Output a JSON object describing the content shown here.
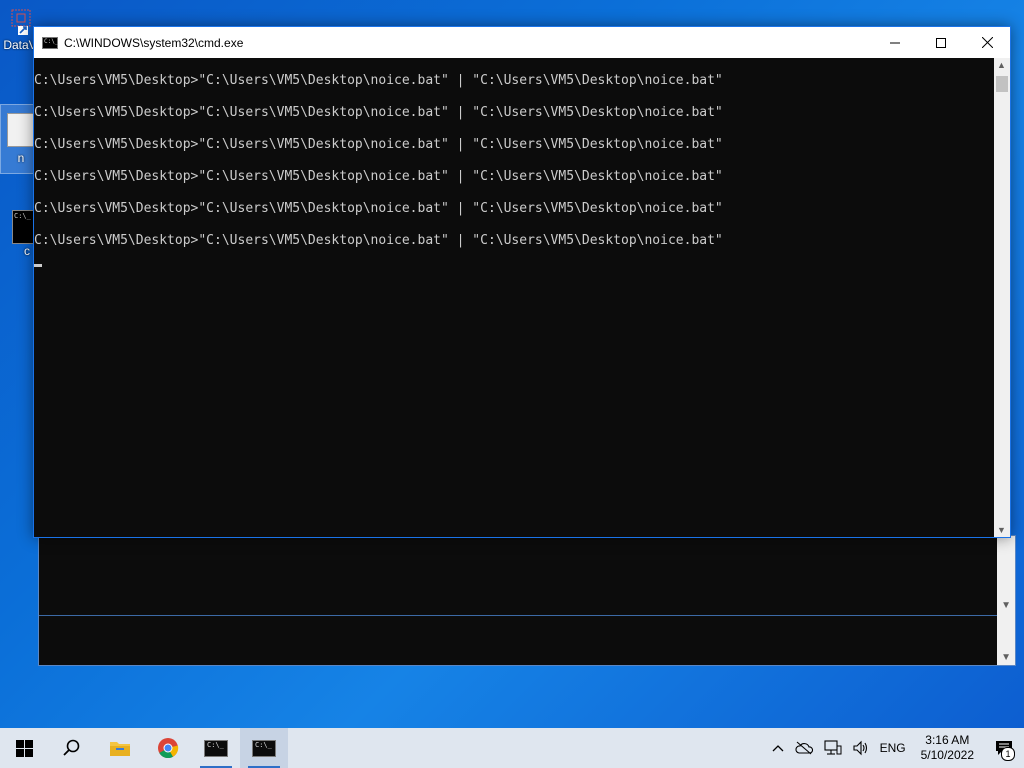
{
  "desktop": {
    "icons": [
      {
        "label": "DataV"
      },
      {
        "label": "n"
      },
      {
        "label": "c"
      }
    ]
  },
  "window": {
    "title": "C:\\WINDOWS\\system32\\cmd.exe",
    "app_icon_text": "C:\\_",
    "controls": {
      "minimize": "—",
      "maximize": "☐",
      "close": "✕"
    },
    "console_lines": [
      "C:\\Users\\VM5\\Desktop>\"C:\\Users\\VM5\\Desktop\\noice.bat\" | \"C:\\Users\\VM5\\Desktop\\noice.bat\"",
      "C:\\Users\\VM5\\Desktop>\"C:\\Users\\VM5\\Desktop\\noice.bat\" | \"C:\\Users\\VM5\\Desktop\\noice.bat\"",
      "C:\\Users\\VM5\\Desktop>\"C:\\Users\\VM5\\Desktop\\noice.bat\" | \"C:\\Users\\VM5\\Desktop\\noice.bat\"",
      "C:\\Users\\VM5\\Desktop>\"C:\\Users\\VM5\\Desktop\\noice.bat\" | \"C:\\Users\\VM5\\Desktop\\noice.bat\"",
      "C:\\Users\\VM5\\Desktop>\"C:\\Users\\VM5\\Desktop\\noice.bat\" | \"C:\\Users\\VM5\\Desktop\\noice.bat\"",
      "C:\\Users\\VM5\\Desktop>\"C:\\Users\\VM5\\Desktop\\noice.bat\" | \"C:\\Users\\VM5\\Desktop\\noice.bat\""
    ]
  },
  "taskbar": {
    "buttons": [
      {
        "name": "start-button",
        "icon": "windows-logo-icon"
      },
      {
        "name": "search-button",
        "icon": "search-icon"
      },
      {
        "name": "file-explorer-button",
        "icon": "folder-icon"
      },
      {
        "name": "chrome-button",
        "icon": "chrome-icon"
      },
      {
        "name": "cmd-taskbar-button-1",
        "icon": "terminal-icon"
      },
      {
        "name": "cmd-taskbar-button-2",
        "icon": "terminal-icon"
      }
    ],
    "terminal_icon_text": "C:\\_",
    "tray": {
      "language": "ENG",
      "time": "3:16 AM",
      "date": "5/10/2022",
      "notification_count": "1"
    }
  },
  "colors": {
    "accent": "#1a73e8",
    "console_bg": "#0c0c0c",
    "console_text": "#cccccc",
    "taskbar_bg": "#dfe6ef"
  }
}
